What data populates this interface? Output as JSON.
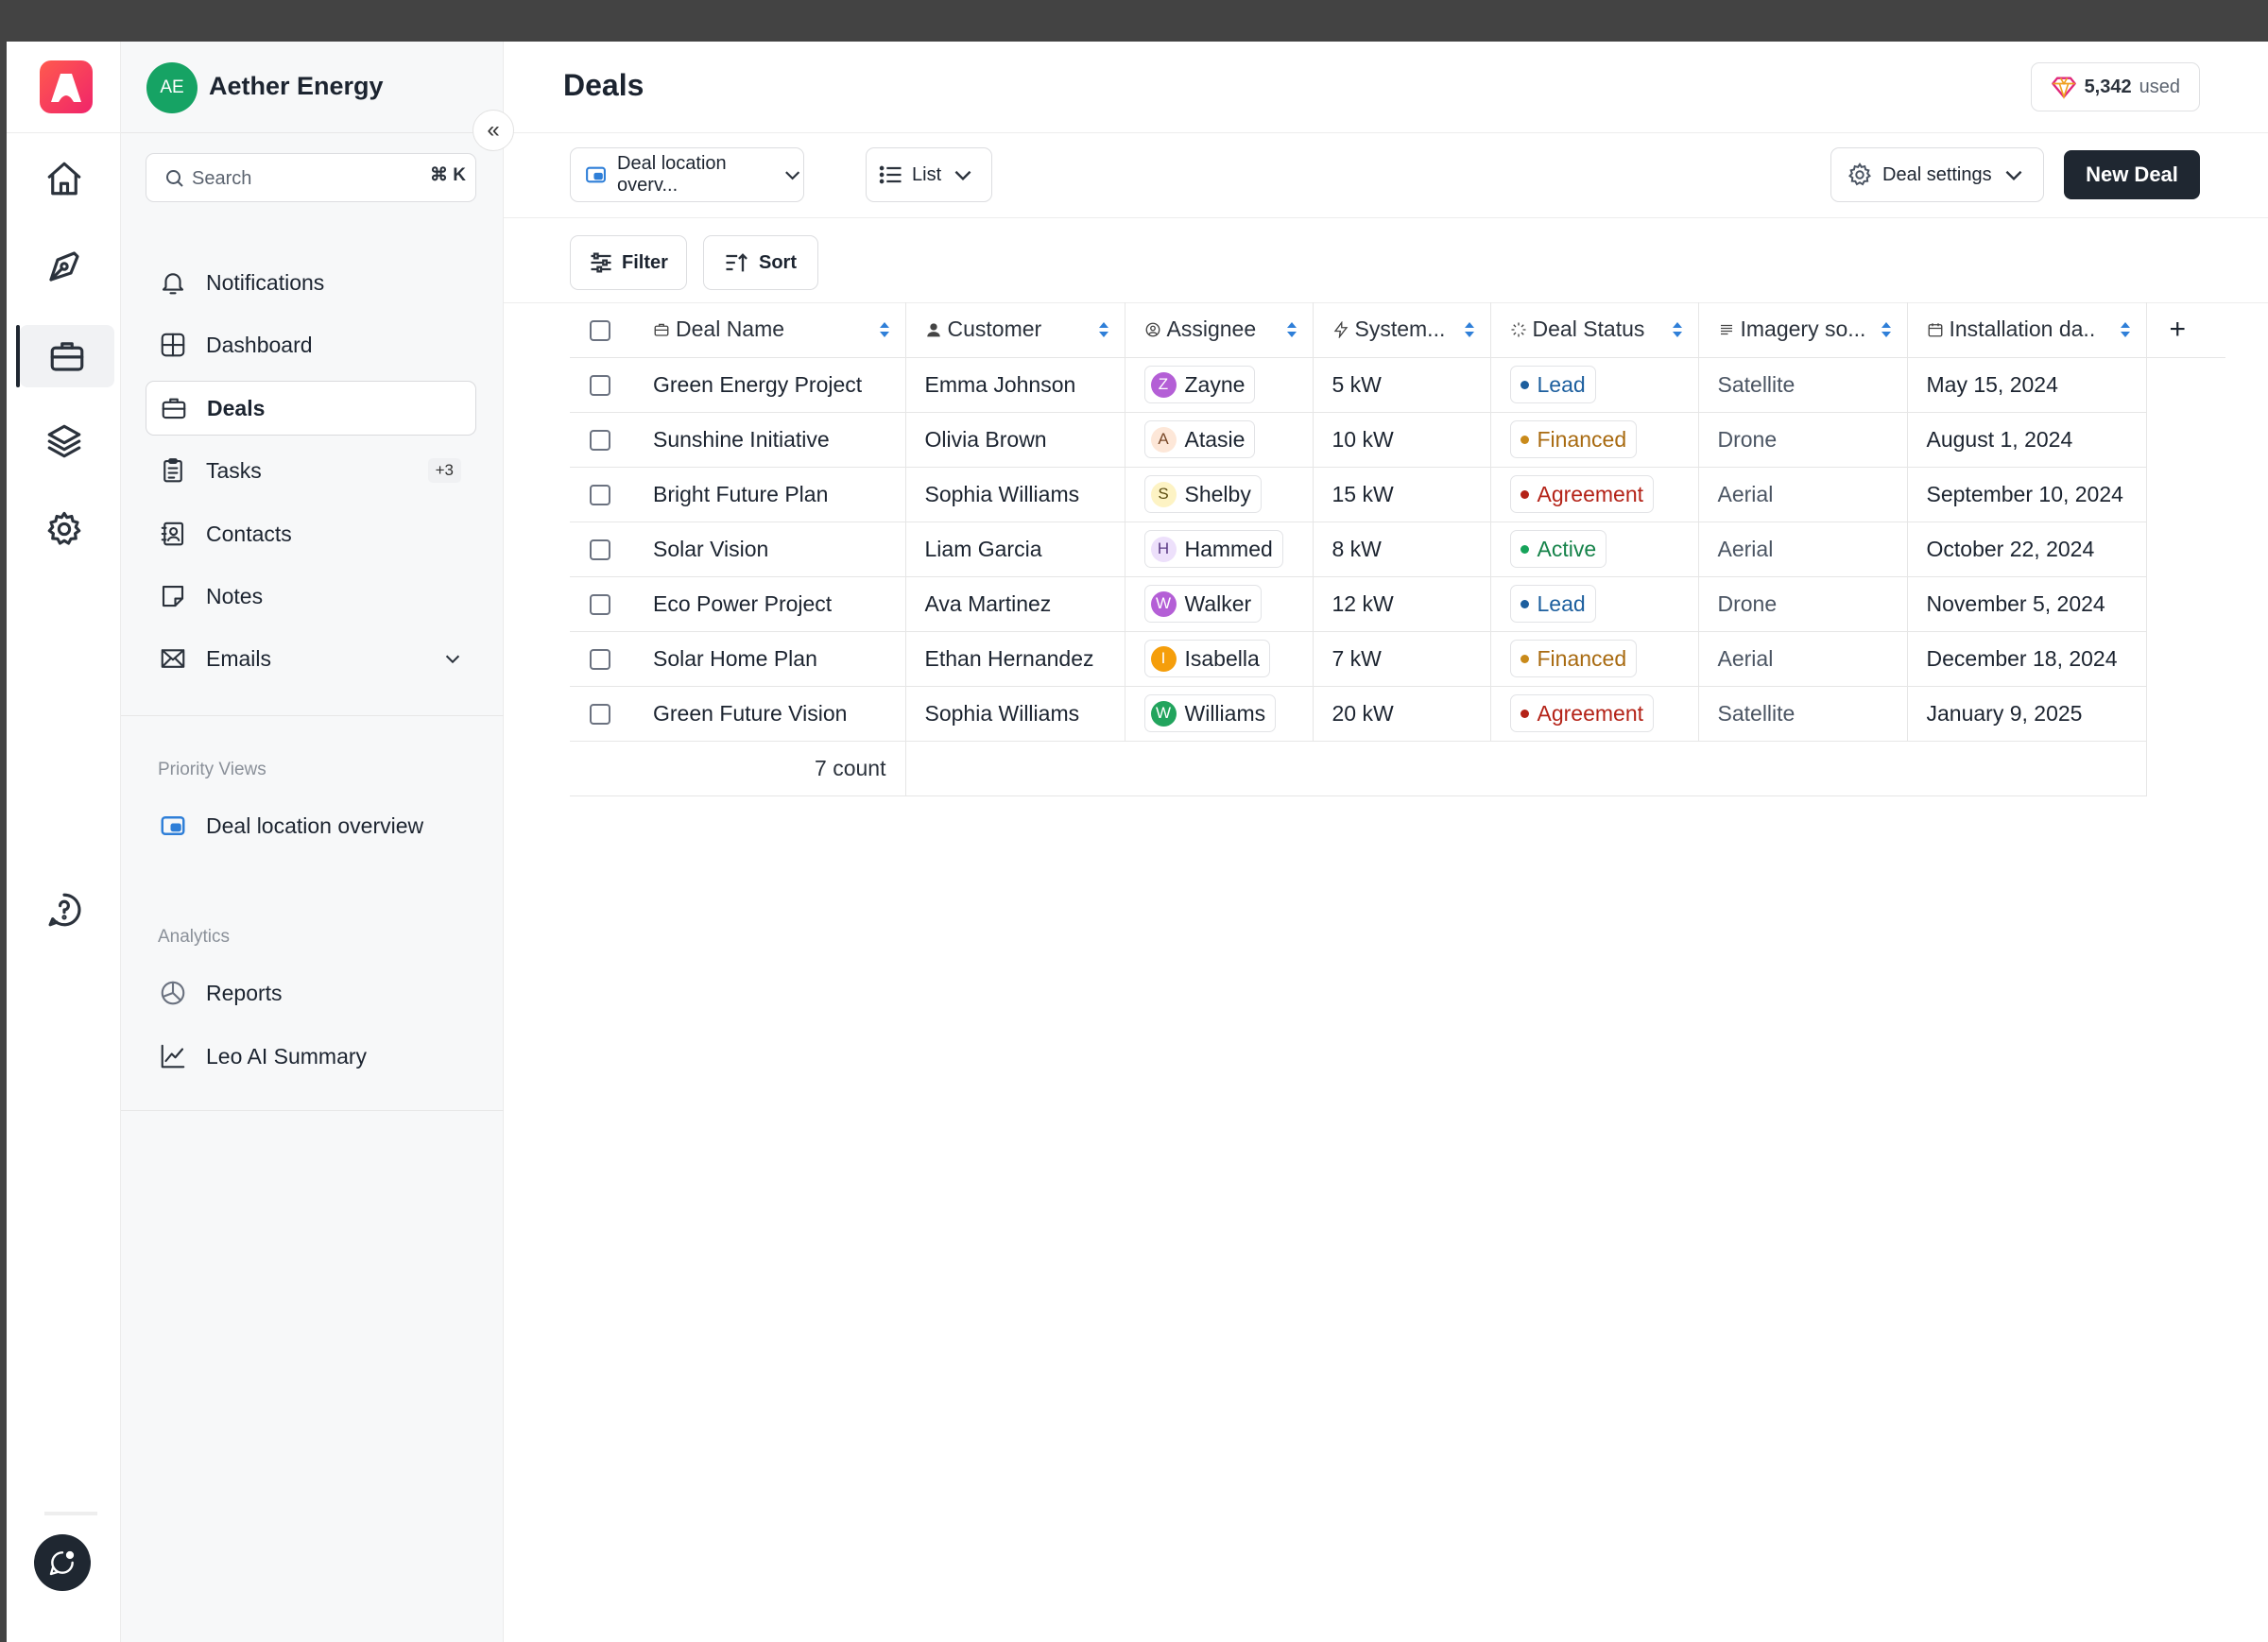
{
  "org": {
    "initials": "AE",
    "name": "Aether Energy"
  },
  "search": {
    "placeholder": "Search",
    "shortcut": "⌘ K"
  },
  "nav": [
    {
      "label": "Notifications",
      "icon": "bell-icon"
    },
    {
      "label": "Dashboard",
      "icon": "dashboard-icon"
    },
    {
      "label": "Deals",
      "icon": "briefcase-icon",
      "selected": true
    },
    {
      "label": "Tasks",
      "icon": "clipboard-icon",
      "badge": "+3"
    },
    {
      "label": "Contacts",
      "icon": "contacts-icon"
    },
    {
      "label": "Notes",
      "icon": "note-icon"
    },
    {
      "label": "Emails",
      "icon": "mail-icon",
      "expandable": true
    }
  ],
  "priority_views": {
    "caption": "Priority Views",
    "items": [
      {
        "label": "Deal location overview",
        "icon": "map-view-icon"
      }
    ]
  },
  "analytics": {
    "caption": "Analytics",
    "items": [
      {
        "label": "Reports",
        "icon": "pie-chart-icon"
      },
      {
        "label": "Leo AI Summary",
        "icon": "trend-chart-icon"
      }
    ]
  },
  "page": {
    "title": "Deals",
    "credits_value": "5,342",
    "credits_suffix": "used"
  },
  "toolbar": {
    "view_select": "Deal location overv...",
    "layout_select": "List",
    "settings": "Deal settings",
    "new_deal": "New Deal",
    "filter": "Filter",
    "sort": "Sort"
  },
  "table": {
    "columns": [
      "Deal Name",
      "Customer",
      "Assignee",
      "System...",
      "Deal Status",
      "Imagery so...",
      "Installation da.."
    ],
    "rows": [
      {
        "deal": "Green Energy Project",
        "customer": "Emma Johnson",
        "assignee": "Zayne",
        "initial": "Z",
        "system": "5 kW",
        "status": "Lead",
        "imagery": "Satellite",
        "date": "May 15, 2024"
      },
      {
        "deal": "Sunshine Initiative",
        "customer": "Olivia Brown",
        "assignee": "Atasie",
        "initial": "A",
        "system": "10 kW",
        "status": "Financed",
        "imagery": "Drone",
        "date": "August 1, 2024"
      },
      {
        "deal": "Bright Future Plan",
        "customer": "Sophia Williams",
        "assignee": "Shelby",
        "initial": "S",
        "system": "15 kW",
        "status": "Agreement",
        "imagery": "Aerial",
        "date": "September 10, 2024"
      },
      {
        "deal": "Solar Vision",
        "customer": "Liam Garcia",
        "assignee": "Hammed",
        "initial": "H",
        "system": "8 kW",
        "status": "Active",
        "imagery": "Aerial",
        "date": "October 22, 2024"
      },
      {
        "deal": "Eco Power Project",
        "customer": "Ava Martinez",
        "assignee": "Walker",
        "initial": "W",
        "system": "12 kW",
        "status": "Lead",
        "imagery": "Drone",
        "date": "November 5, 2024"
      },
      {
        "deal": "Solar Home Plan",
        "customer": "Ethan Hernandez",
        "assignee": "Isabella",
        "initial": "I",
        "system": "7 kW",
        "status": "Financed",
        "imagery": "Aerial",
        "date": "December 18, 2024"
      },
      {
        "deal": "Green Future Vision",
        "customer": "Sophia Williams",
        "assignee": "Williams",
        "initial": "W",
        "system": "20 kW",
        "status": "Agreement",
        "imagery": "Satellite",
        "date": "January 9, 2025"
      }
    ],
    "footer_count": "7 count"
  },
  "avatar_colors": {
    "Zayne": {
      "bg": "#b45fd6",
      "fg": "#ffffff"
    },
    "Atasie": {
      "bg": "#fde7d8",
      "fg": "#7a4a2a"
    },
    "Shelby": {
      "bg": "#fdf3c4",
      "fg": "#5c4d10"
    },
    "Hammed": {
      "bg": "#ede0fb",
      "fg": "#5b3c85"
    },
    "Walker": {
      "bg": "#b45fd6",
      "fg": "#ffffff"
    },
    "Isabella": {
      "bg": "#f59e0b",
      "fg": "#ffffff"
    },
    "Williams": {
      "bg": "#22a45d",
      "fg": "#ffffff"
    }
  },
  "status_colors": {
    "Lead": {
      "text": "#1d5f9e",
      "dot": "#1d5f9e"
    },
    "Financed": {
      "text": "#a86a10",
      "dot": "#c98a1a"
    },
    "Agreement": {
      "text": "#b42318",
      "dot": "#b42318"
    },
    "Active": {
      "text": "#16834a",
      "dot": "#16a35a"
    }
  },
  "colors": {
    "accent": "#1f2731",
    "brand": "#f0246a",
    "link_blue": "#2f7fd8"
  }
}
